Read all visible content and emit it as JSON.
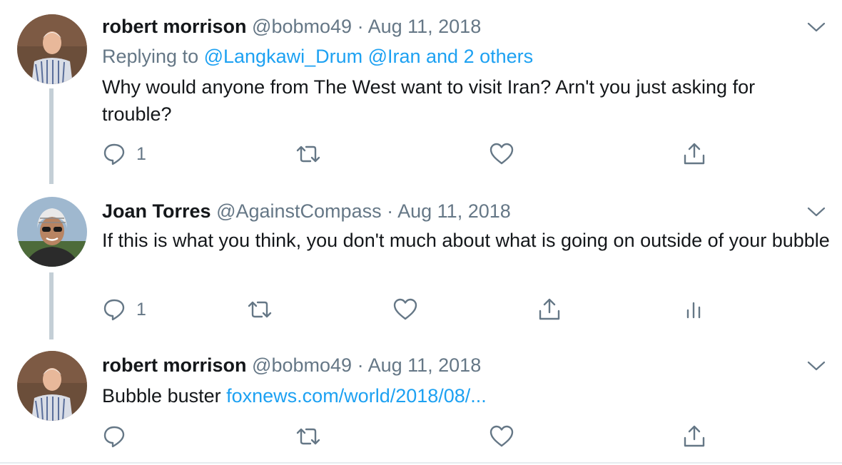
{
  "tweets": [
    {
      "name": "robert morrison",
      "handle": "@bobmo49",
      "separator": "·",
      "date": "Aug 11, 2018",
      "replying_prefix": "Replying to ",
      "replying_links": "@Langkawi_Drum @Iran and 2 others",
      "text": "Why would anyone from The West  want to visit Iran? Arn't you just asking for trouble?",
      "reply_count": "1",
      "avatar_icon": "avatar-older-man-checked-shirt"
    },
    {
      "name": "Joan Torres",
      "handle": "@AgainstCompass",
      "separator": "·",
      "date": "Aug 11, 2018",
      "text": "If this is what you think, you don't much about what is going on outside of your bubble",
      "reply_count": "1",
      "avatar_icon": "avatar-man-sunglasses-keffiyeh"
    },
    {
      "name": "robert morrison",
      "handle": "@bobmo49",
      "separator": "·",
      "date": "Aug 11, 2018",
      "text_prefix": "Bubble buster ",
      "link_text": "foxnews.com/world/2018/08/...",
      "avatar_icon": "avatar-older-man-checked-shirt"
    }
  ],
  "colors": {
    "link": "#1da1f2",
    "secondary_text": "#657786",
    "thread_line": "#c4cfd6"
  }
}
